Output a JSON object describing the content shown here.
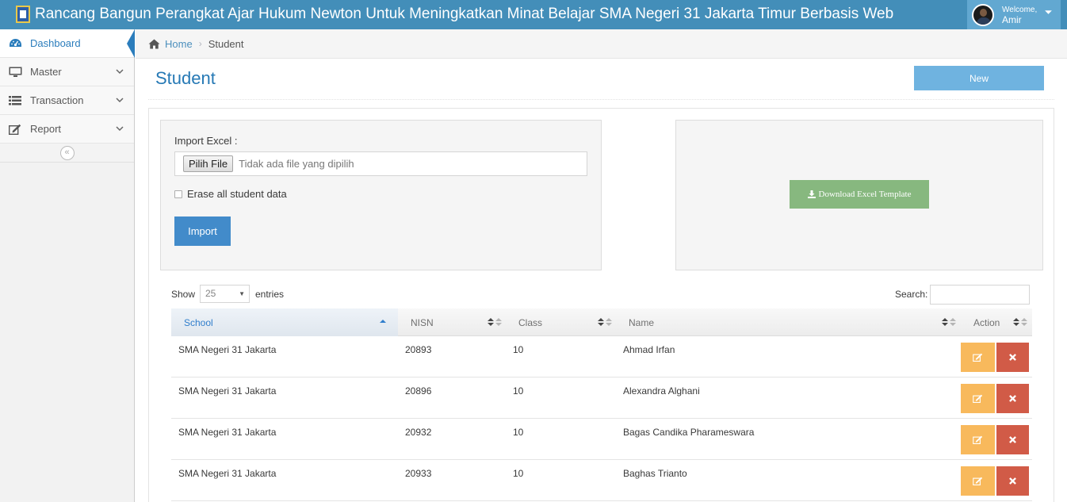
{
  "app": {
    "title": "Rancang Bangun Perangkat Ajar Hukum Newton Untuk Meningkatkan Minat Belajar SMA Negeri 31 Jakarta Timur Berbasis Web",
    "welcome": "Welcome,",
    "user_name": "Amir"
  },
  "sidebar": {
    "items": [
      {
        "label": "Dashboard",
        "icon": "dashboard-icon"
      },
      {
        "label": "Master",
        "icon": "desktop-icon"
      },
      {
        "label": "Transaction",
        "icon": "list-icon"
      },
      {
        "label": "Report",
        "icon": "edit-icon"
      }
    ]
  },
  "breadcrumb": {
    "home": "Home",
    "current": "Student"
  },
  "page": {
    "title": "Student",
    "new_button": "New"
  },
  "import_form": {
    "label": "Import Excel :",
    "file_button": "Pilih File",
    "file_name": "Tidak ada file yang dipilih",
    "erase_label": "Erase all student data",
    "erase_checked": false,
    "import_button": "Import"
  },
  "download": {
    "button_label": "Download Excel Template"
  },
  "table_controls": {
    "show_label": "Show",
    "entries_value": "25",
    "entries_label": "entries",
    "search_label": "Search:",
    "search_value": ""
  },
  "table": {
    "columns": [
      "School",
      "NISN",
      "Class",
      "Name",
      "Action"
    ],
    "sorted_column": "School",
    "sort_direction": "asc",
    "rows": [
      {
        "school": "SMA Negeri 31 Jakarta",
        "nisn": "20893",
        "class": "10",
        "name": "Ahmad Irfan"
      },
      {
        "school": "SMA Negeri 31 Jakarta",
        "nisn": "20896",
        "class": "10",
        "name": "Alexandra Alghani"
      },
      {
        "school": "SMA Negeri 31 Jakarta",
        "nisn": "20932",
        "class": "10",
        "name": "Bagas Candika Pharameswara"
      },
      {
        "school": "SMA Negeri 31 Jakarta",
        "nisn": "20933",
        "class": "10",
        "name": "Baghas Trianto"
      }
    ]
  },
  "colors": {
    "navbar": "#438eb9",
    "accent": "#2679b5",
    "new_button": "#6fb3e0",
    "import_button": "#428bca",
    "download_button": "#87b87f",
    "edit_button": "#f8b95c",
    "delete_button": "#d15b47"
  }
}
